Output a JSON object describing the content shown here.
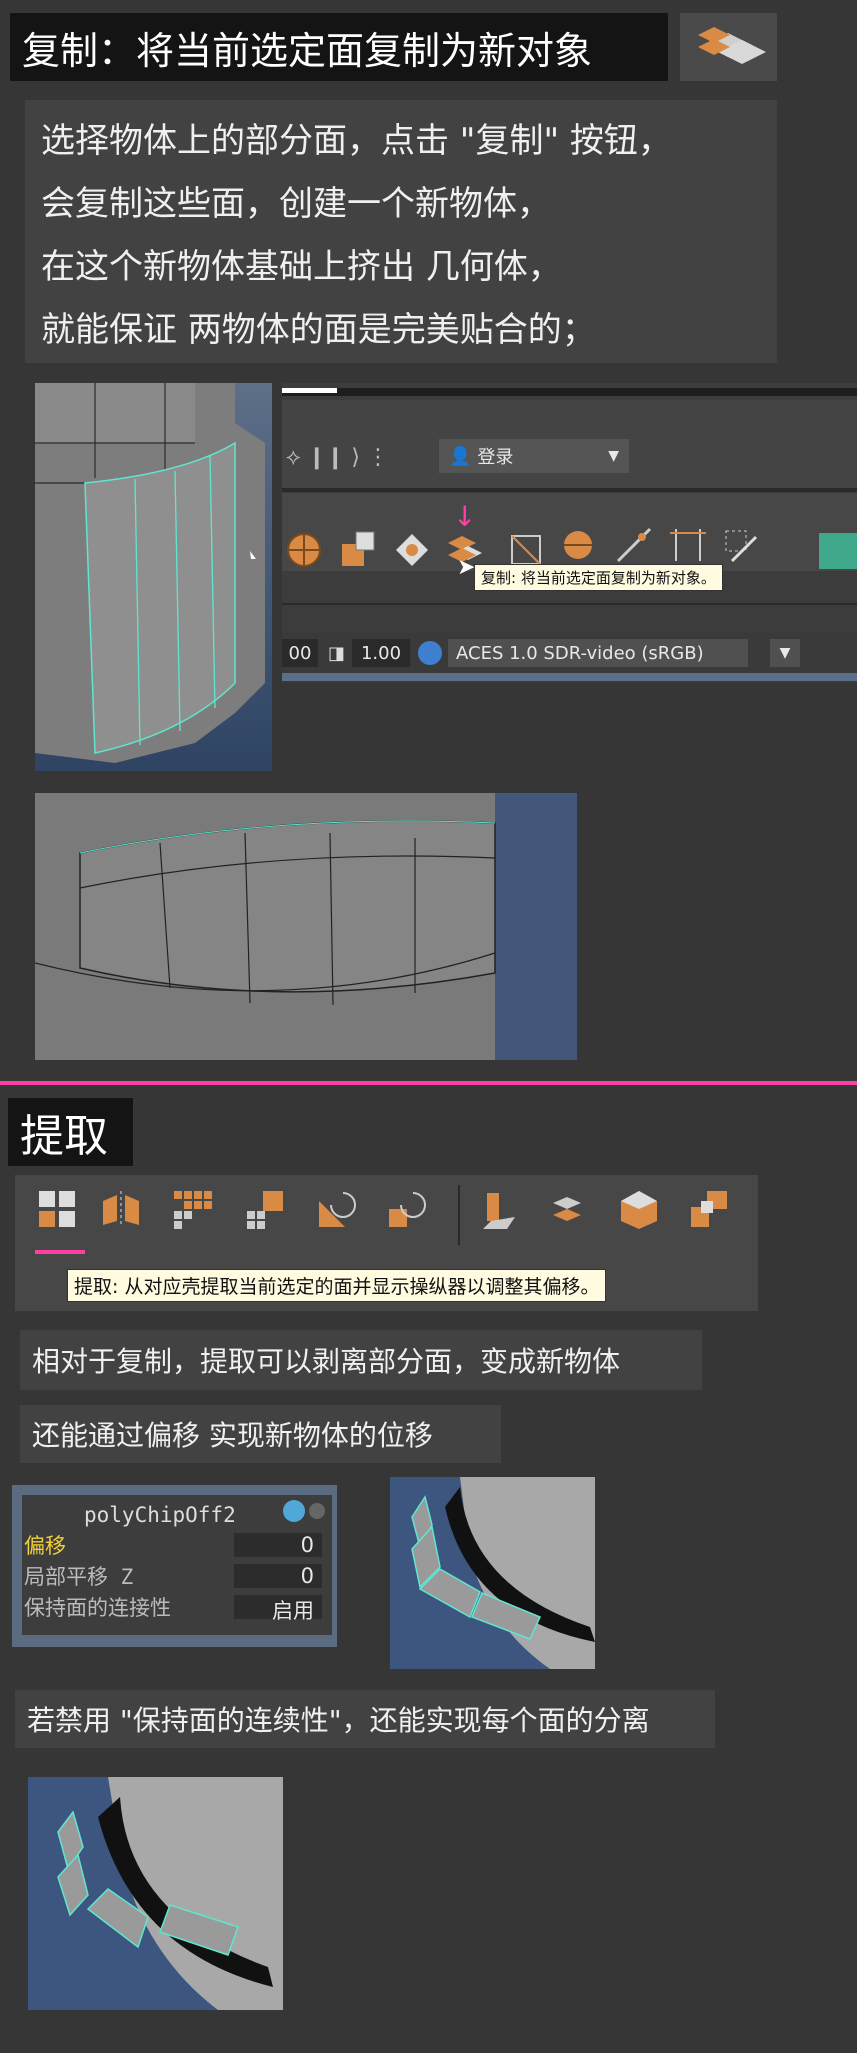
{
  "section1": {
    "title": "复制：将当前选定面复制为新对象",
    "title_icon": "duplicate-face-icon",
    "description_lines": [
      "选择物体上的部分面，点击 \"复制\" 按钮，",
      "会复制这些面，创建一个新物体，",
      "在这个新物体基础上挤出 几何体，",
      "就能保证 两物体的面是完美贴合的；"
    ],
    "maya_ui": {
      "login_label": "登录",
      "tooltip": "复制: 将当前选定面复制为新对象。",
      "value_left": "00",
      "value_gamma": "1.00",
      "colorspace": "ACES 1.0 SDR-video (sRGB)"
    }
  },
  "section2": {
    "title": "提取",
    "tooltip": "提取: 从对应壳提取当前选定的面并显示操纵器以调整其偏移。",
    "notes": [
      "相对于复制，提取可以剥离部分面，变成新物体",
      "还能通过偏移 实现新物体的位移"
    ],
    "attribute_panel": {
      "node_name": "polyChipOff2",
      "rows": [
        {
          "label": "偏移",
          "value": "0"
        },
        {
          "label": "局部平移 Z",
          "value": "0"
        },
        {
          "label": "保持面的连接性",
          "value": "启用"
        }
      ]
    },
    "note_disable": "若禁用 \"保持面的连续性\"，还能实现每个面的分离"
  },
  "colors": {
    "background": "#363636",
    "accent_pink": "#ff3fa4",
    "icon_orange": "#d98a45",
    "wire_cyan": "#5fe6d0",
    "tooltip_bg": "#fffbe0"
  }
}
